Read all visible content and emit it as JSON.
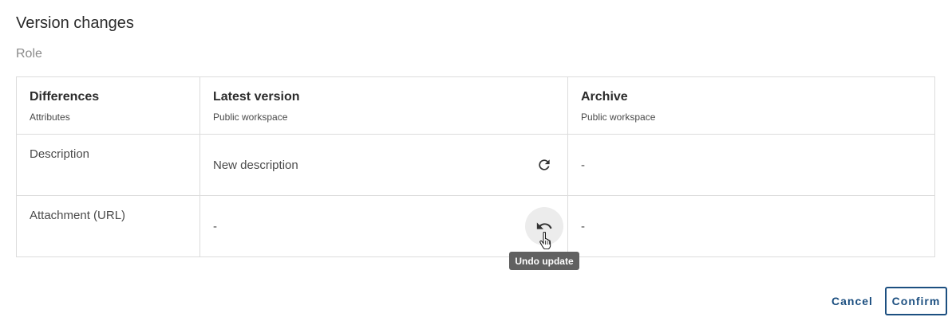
{
  "dialog": {
    "title": "Version changes",
    "subtitle": "Role"
  },
  "table": {
    "headers": [
      {
        "title": "Differences",
        "sub": "Attributes"
      },
      {
        "title": "Latest version",
        "sub": "Public workspace"
      },
      {
        "title": "Archive",
        "sub": "Public workspace"
      }
    ],
    "rows": [
      {
        "attribute": "Description",
        "latest": "New description",
        "archive": "-",
        "action_icon": "refresh-icon"
      },
      {
        "attribute": "Attachment (URL)",
        "latest": "-",
        "archive": "-",
        "action_icon": "undo-icon"
      }
    ]
  },
  "tooltip": {
    "text": "Undo update"
  },
  "footer": {
    "cancel_label": "Cancel",
    "confirm_label": "Confirm"
  },
  "colors": {
    "accent": "#1c4f80",
    "tooltip_bg": "#616161",
    "border": "#dcdcdc"
  }
}
